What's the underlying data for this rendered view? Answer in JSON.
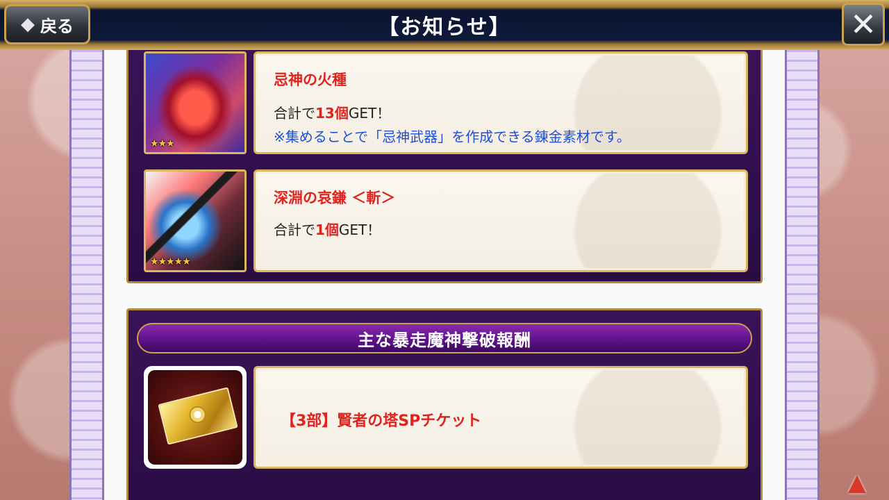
{
  "header": {
    "title": "【お知らせ】",
    "back_label": "戻る"
  },
  "items": [
    {
      "name": "忌神の火種",
      "stars": "★★★",
      "line_prefix": "合計で",
      "count": "13個",
      "line_suffix": "GET！",
      "note": "※集めることで「忌神武器」を作成できる錬金素材です。"
    },
    {
      "name": "深淵の哀鎌 ＜斬＞",
      "stars": "★★★★★",
      "line_prefix": "合計で",
      "count": "1個",
      "line_suffix": "GET！"
    }
  ],
  "rewards": {
    "banner": "主な暴走魔神撃破報酬",
    "items": [
      {
        "name": "【3部】賢者の塔SPチケット"
      }
    ]
  },
  "colors": {
    "highlight_red": "#e0231e",
    "note_blue": "#1f4fd8",
    "section_purple": "#2a0c44",
    "frame_gold": "#d8b662"
  }
}
